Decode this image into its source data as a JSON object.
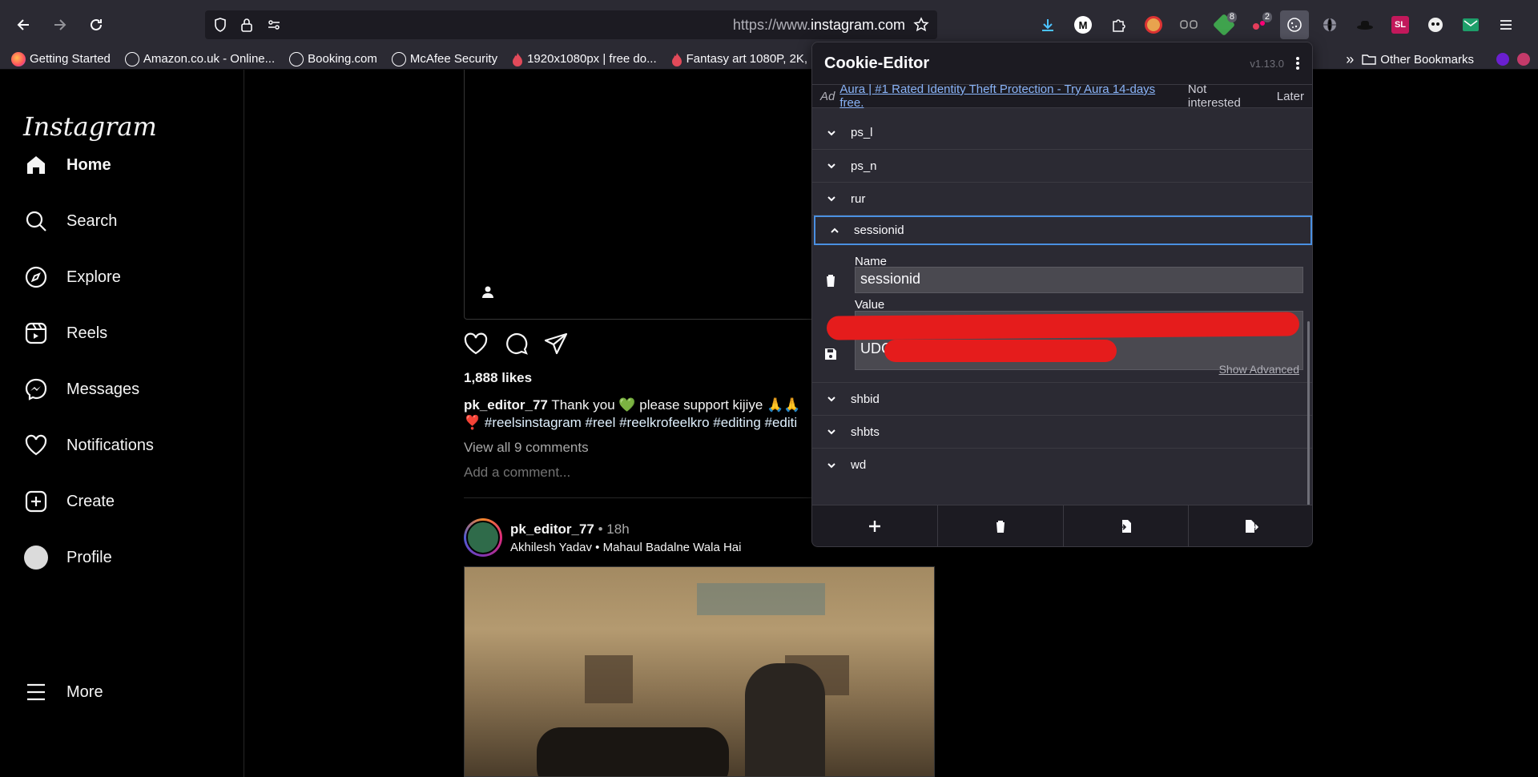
{
  "browser": {
    "url_prefix": "https://www.",
    "url_domain": "instagram.com",
    "extension_badges": [
      "8",
      "2"
    ],
    "ext_sl_label": "SL",
    "ext_m_label": "M"
  },
  "bookmarks": {
    "items": [
      {
        "label": "Getting Started",
        "icon": "firefox-icon"
      },
      {
        "label": "Amazon.co.uk - Online...",
        "icon": "globe-icon"
      },
      {
        "label": "Booking.com",
        "icon": "globe-icon"
      },
      {
        "label": "McAfee Security",
        "icon": "globe-icon"
      },
      {
        "label": "1920x1080px | free do...",
        "icon": "flame-icon"
      },
      {
        "label": "Fantasy art 1080P, 2K, ...",
        "icon": "flame-icon"
      }
    ],
    "other_label": "Other Bookmarks"
  },
  "instagram": {
    "logo": "Instagram",
    "nav": [
      {
        "label": "Home",
        "icon": "home-icon"
      },
      {
        "label": "Search",
        "icon": "search-icon"
      },
      {
        "label": "Explore",
        "icon": "compass-icon"
      },
      {
        "label": "Reels",
        "icon": "reels-icon"
      },
      {
        "label": "Messages",
        "icon": "messenger-icon"
      },
      {
        "label": "Notifications",
        "icon": "heart-icon"
      },
      {
        "label": "Create",
        "icon": "plus-square-icon"
      },
      {
        "label": "Profile",
        "icon": "avatar-icon"
      }
    ],
    "more_label": "More",
    "post1": {
      "likes": "1,888 likes",
      "username": "pk_editor_77",
      "caption": "Thank you 💚 please support kijiye 🙏🙏",
      "tags": "❣️ #reelsinstagram #reel #reelkrofeelkro #editing #editi",
      "view_comments": "View all 9 comments",
      "add_comment": "Add a comment..."
    },
    "post2": {
      "username": "pk_editor_77",
      "time": "• 18h",
      "audio": "Akhilesh Yadav • Mahaul Badalne Wala Hai"
    }
  },
  "cookie_editor": {
    "title": "Cookie-Editor",
    "version": "v1.13.0",
    "ad": {
      "tag": "Ad",
      "text": "Aura | #1 Rated Identity Theft Protection - Try Aura 14-days free.",
      "not_interested": "Not interested",
      "later": "Later"
    },
    "cookies_before": [
      "ps_l",
      "ps_n",
      "rur"
    ],
    "open_cookie": "sessionid",
    "name_label": "Name",
    "name_value": "sessionid",
    "value_label": "Value",
    "value_visible": "UDC",
    "show_advanced": "Show Advanced",
    "cookies_after": [
      "shbid",
      "shbts",
      "wd"
    ]
  }
}
